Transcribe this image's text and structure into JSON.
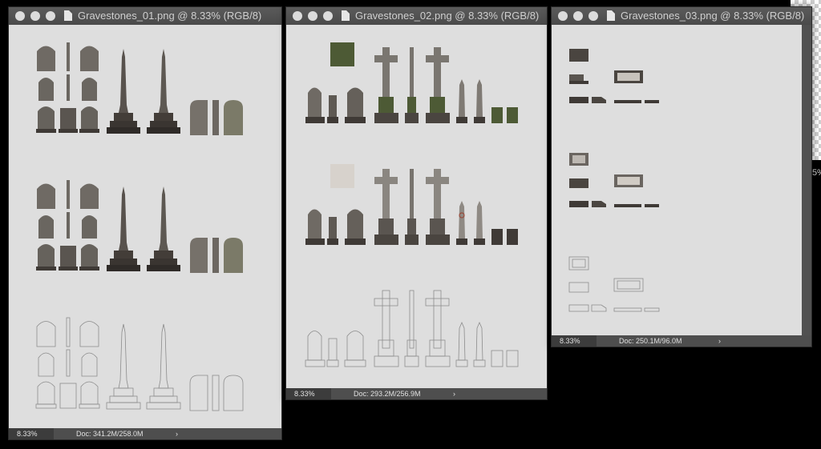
{
  "windows": [
    {
      "title": "Gravestones_01.png @ 8.33% (RGB/8)",
      "zoom": "8.33%",
      "doc": "Doc: 341.2M/258.0M",
      "arrow": "›"
    },
    {
      "title": "Gravestones_02.png @ 8.33% (RGB/8)",
      "zoom": "8.33%",
      "doc": "Doc: 293.2M/256.9M",
      "arrow": "›"
    },
    {
      "title": "Gravestones_03.png @ 8.33% (RGB/8)",
      "zoom": "8.33%",
      "doc": "Doc: 250.1M/96.0M",
      "arrow": "›"
    }
  ],
  "edge_text": "5%",
  "colors": {
    "stone": "#6f6a64",
    "stone_dark": "#3f3a36",
    "moss": "#4d5a35",
    "outline": "#8c8c8c",
    "canvas": "#dedede"
  }
}
